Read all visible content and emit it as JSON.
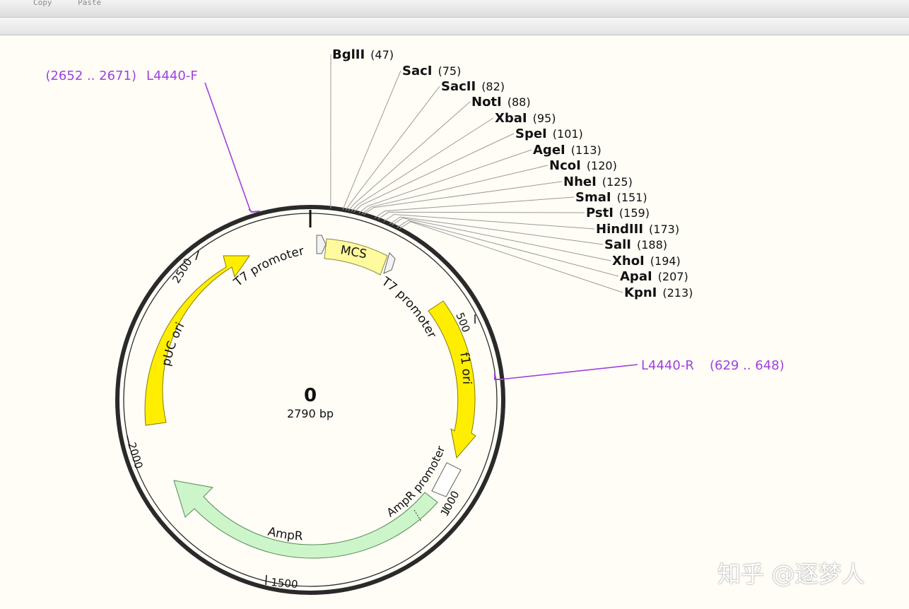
{
  "toolbar": {
    "copy_label": "Copy",
    "paste_label": "Paste"
  },
  "map": {
    "center_title": "0",
    "size_label": "2790 bp",
    "total_bp": 2790,
    "ticks": [
      {
        "label": "500",
        "pos": 500
      },
      {
        "label": "1000",
        "pos": 1000
      },
      {
        "label": "1500",
        "pos": 1500
      },
      {
        "label": "2000",
        "pos": 2000
      },
      {
        "label": "2500",
        "pos": 2500
      }
    ],
    "features": {
      "mcs": "MCS",
      "t7_left": "T7 promoter",
      "t7_right": "T7 promoter",
      "f1_ori": "f1 ori",
      "puc_ori": "pUC ori",
      "ampr_promoter": "AmpR promoter",
      "ampr": "AmpR"
    },
    "primers": [
      {
        "name": "L4440-F",
        "range": "(2652 .. 2671)"
      },
      {
        "name": "L4440-R",
        "range": "(629 .. 648)"
      }
    ],
    "enzymes": [
      {
        "name": "BglII",
        "pos": "(47)"
      },
      {
        "name": "SacI",
        "pos": "(75)"
      },
      {
        "name": "SacII",
        "pos": "(82)"
      },
      {
        "name": "NotI",
        "pos": "(88)"
      },
      {
        "name": "XbaI",
        "pos": "(95)"
      },
      {
        "name": "SpeI",
        "pos": "(101)"
      },
      {
        "name": "AgeI",
        "pos": "(113)"
      },
      {
        "name": "NcoI",
        "pos": "(120)"
      },
      {
        "name": "NheI",
        "pos": "(125)"
      },
      {
        "name": "SmaI",
        "pos": "(151)"
      },
      {
        "name": "PstI",
        "pos": "(159)"
      },
      {
        "name": "HindIII",
        "pos": "(173)"
      },
      {
        "name": "SalI",
        "pos": "(188)"
      },
      {
        "name": "XhoI",
        "pos": "(194)"
      },
      {
        "name": "ApaI",
        "pos": "(207)"
      },
      {
        "name": "KpnI",
        "pos": "(213)"
      }
    ],
    "colors": {
      "ori": "#ffee00",
      "ampr": "#ccf5c9",
      "mcs": "#fffa9e",
      "primer": "#a040e0",
      "backbone": "#2a2a2a"
    }
  },
  "watermark": "知乎 @逐梦人"
}
